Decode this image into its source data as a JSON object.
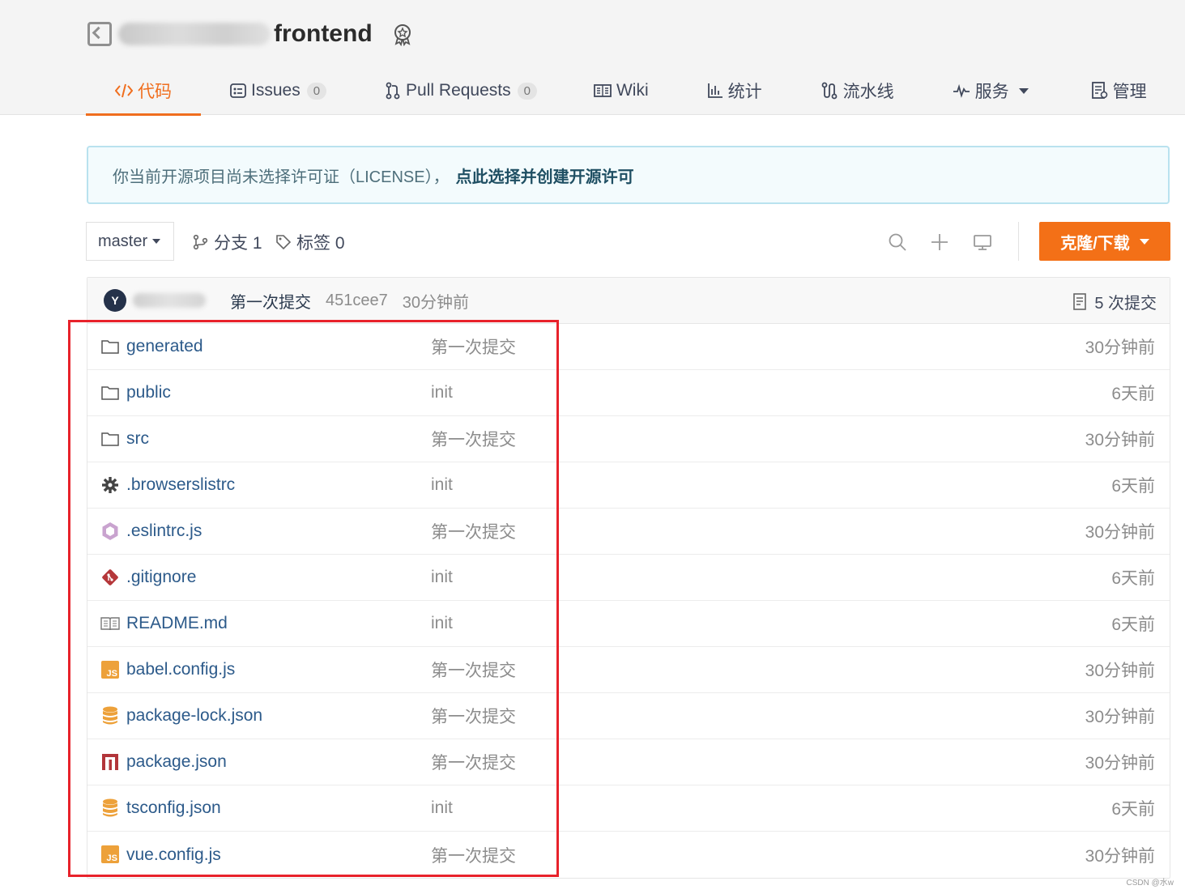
{
  "repo": {
    "owner_blurred": true,
    "name": "frontend"
  },
  "tabs": [
    {
      "label": "代码",
      "icon": "code-icon",
      "active": true
    },
    {
      "label": "Issues",
      "icon": "issues-icon",
      "count": "0"
    },
    {
      "label": "Pull Requests",
      "icon": "pull-request-icon",
      "count": "0"
    },
    {
      "label": "Wiki",
      "icon": "wiki-icon"
    },
    {
      "label": "统计",
      "icon": "stats-icon"
    },
    {
      "label": "流水线",
      "icon": "pipeline-icon"
    },
    {
      "label": "服务",
      "icon": "service-icon",
      "dropdown": true
    },
    {
      "label": "管理",
      "icon": "manage-icon"
    }
  ],
  "notice": {
    "text": "你当前开源项目尚未选择许可证（LICENSE），",
    "link": "点此选择并创建开源许可"
  },
  "toolbar": {
    "branch": "master",
    "branches_label": "分支 1",
    "tags_label": "标签 0",
    "clone_label": "克隆/下载"
  },
  "latest_commit": {
    "avatar_letter": "Y",
    "message": "第一次提交",
    "hash": "451cee7",
    "time": "30分钟前",
    "count_label": "5 次提交"
  },
  "files": [
    {
      "name": "generated",
      "type": "folder",
      "icon": "folder-icon",
      "message": "第一次提交",
      "time": "30分钟前"
    },
    {
      "name": "public",
      "type": "folder",
      "icon": "folder-icon",
      "message": "init",
      "time": "6天前"
    },
    {
      "name": "src",
      "type": "folder",
      "icon": "folder-icon",
      "message": "第一次提交",
      "time": "30分钟前"
    },
    {
      "name": ".browserslistrc",
      "type": "file",
      "icon": "gear-icon",
      "message": "init",
      "time": "6天前"
    },
    {
      "name": ".eslintrc.js",
      "type": "file",
      "icon": "eslint-icon",
      "message": "第一次提交",
      "time": "30分钟前"
    },
    {
      "name": ".gitignore",
      "type": "file",
      "icon": "git-icon",
      "message": "init",
      "time": "6天前"
    },
    {
      "name": "README.md",
      "type": "file",
      "icon": "readme-icon",
      "message": "init",
      "time": "6天前"
    },
    {
      "name": "babel.config.js",
      "type": "file",
      "icon": "js-file-icon",
      "message": "第一次提交",
      "time": "30分钟前"
    },
    {
      "name": "package-lock.json",
      "type": "file",
      "icon": "database-icon",
      "message": "第一次提交",
      "time": "30分钟前"
    },
    {
      "name": "package.json",
      "type": "file",
      "icon": "npm-icon",
      "message": "第一次提交",
      "time": "30分钟前"
    },
    {
      "name": "tsconfig.json",
      "type": "file",
      "icon": "database-icon",
      "message": "init",
      "time": "6天前"
    },
    {
      "name": "vue.config.js",
      "type": "file",
      "icon": "js-file-icon",
      "message": "第一次提交",
      "time": "30分钟前"
    }
  ],
  "watermark": "CSDN @水w",
  "colors": {
    "accent": "#f06e1e",
    "clone_button": "#f37017",
    "link": "#2c5a8a",
    "highlight": "#e8222b"
  }
}
